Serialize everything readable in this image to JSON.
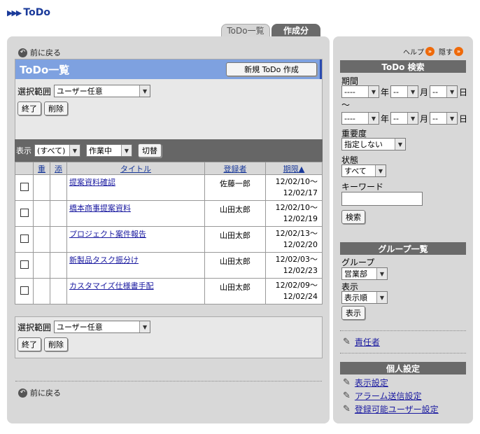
{
  "header": {
    "title": "ToDo"
  },
  "tabs": [
    {
      "label": "ToDo一覧"
    },
    {
      "label": "作成分"
    }
  ],
  "back_link": "前に戻る",
  "list": {
    "title": "ToDo一覧",
    "new_button": "新規 ToDo 作成",
    "range_label": "選択範囲",
    "range_value": "ユーザー任意",
    "finish_button": "終了",
    "delete_button": "削除"
  },
  "filter": {
    "label": "表示",
    "scope_value": "(すべて)",
    "status_value": "作業中",
    "switch_button": "切替"
  },
  "table": {
    "headers": {
      "priority": "重",
      "attach": "添",
      "title": "タイトル",
      "registrant": "登録者",
      "due": "期限▲"
    },
    "rows": [
      {
        "title": "提案資料確認",
        "registrant": "佐藤一郎",
        "start": "12/02/10～",
        "end": "12/02/17"
      },
      {
        "title": "橋本商事提案資料",
        "registrant": "山田太郎",
        "start": "12/02/10～",
        "end": "12/02/19"
      },
      {
        "title": "プロジェクト案件報告",
        "registrant": "山田太郎",
        "start": "12/02/13～",
        "end": "12/02/20"
      },
      {
        "title": "新製品タスク振分け",
        "registrant": "山田太郎",
        "start": "12/02/03～",
        "end": "12/02/23"
      },
      {
        "title": "カスタマイズ仕様書手配",
        "registrant": "山田太郎",
        "start": "12/02/09～",
        "end": "12/02/24"
      }
    ]
  },
  "bottom": {
    "range_label": "選択範囲",
    "range_value": "ユーザー任意",
    "finish_button": "終了",
    "delete_button": "削除"
  },
  "side": {
    "help": "ヘルプ",
    "hide": "隠す",
    "search_title": "ToDo 検索",
    "period_label": "期間",
    "date_placeholder_year": "----",
    "date_placeholder": "--",
    "year": "年",
    "month": "月",
    "day": "日",
    "tilde": "～",
    "importance_label": "重要度",
    "importance_value": "指定しない",
    "status_label": "状態",
    "status_value": "すべて",
    "keyword_label": "キーワード",
    "search_button": "検索",
    "group_title": "グループ一覧",
    "group_label": "グループ",
    "group_value": "営業部",
    "display_label": "表示",
    "display_value": "表示順",
    "display_button": "表示",
    "responsible_link": "責任者",
    "personal_title": "個人設定",
    "links": [
      "表示設定",
      "アラーム送信設定",
      "登録可能ユーザー設定"
    ]
  }
}
